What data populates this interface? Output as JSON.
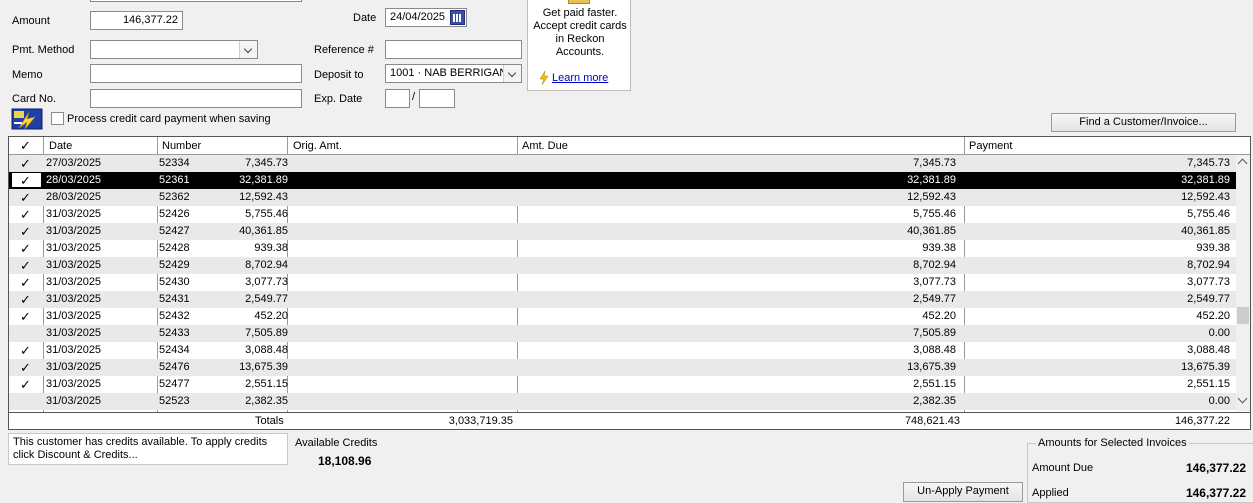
{
  "form": {
    "amount_label": "Amount",
    "amount_value": "146,377.22",
    "date_label": "Date",
    "date_value": "24/04/2025",
    "pmt_method_label": "Pmt. Method",
    "pmt_method_value": "",
    "reference_label": "Reference #",
    "reference_value": "",
    "memo_label": "Memo",
    "memo_value": "",
    "deposit_label": "Deposit to",
    "deposit_value": "1001 · NAB BERRIGAN",
    "cardno_label": "Card No.",
    "cardno_value": "",
    "expdate_label": "Exp. Date",
    "exp_sep": "/",
    "process_cc_label": "Process credit card payment when saving"
  },
  "ad": {
    "text_line1": "Get paid faster.",
    "text_line2": "Accept credit cards",
    "text_line3": "in Reckon",
    "text_line4": "Accounts.",
    "link": "Learn more"
  },
  "find_button": "Find a Customer/Invoice...",
  "table": {
    "headers": {
      "check": "✓",
      "date": "Date",
      "number": "Number",
      "orig": "Orig. Amt.",
      "due": "Amt. Due",
      "payment": "Payment"
    },
    "rows": [
      {
        "check": "✓",
        "date": "27/03/2025",
        "number": "52334",
        "orig": "7,345.73",
        "due": "7,345.73",
        "payment": "7,345.73"
      },
      {
        "check": "✓",
        "date": "28/03/2025",
        "number": "52361",
        "orig": "32,381.89",
        "due": "32,381.89",
        "payment": "32,381.89"
      },
      {
        "check": "✓",
        "date": "28/03/2025",
        "number": "52362",
        "orig": "12,592.43",
        "due": "12,592.43",
        "payment": "12,592.43"
      },
      {
        "check": "✓",
        "date": "31/03/2025",
        "number": "52426",
        "orig": "5,755.46",
        "due": "5,755.46",
        "payment": "5,755.46"
      },
      {
        "check": "✓",
        "date": "31/03/2025",
        "number": "52427",
        "orig": "40,361.85",
        "due": "40,361.85",
        "payment": "40,361.85"
      },
      {
        "check": "✓",
        "date": "31/03/2025",
        "number": "52428",
        "orig": "939.38",
        "due": "939.38",
        "payment": "939.38"
      },
      {
        "check": "✓",
        "date": "31/03/2025",
        "number": "52429",
        "orig": "8,702.94",
        "due": "8,702.94",
        "payment": "8,702.94"
      },
      {
        "check": "✓",
        "date": "31/03/2025",
        "number": "52430",
        "orig": "3,077.73",
        "due": "3,077.73",
        "payment": "3,077.73"
      },
      {
        "check": "✓",
        "date": "31/03/2025",
        "number": "52431",
        "orig": "2,549.77",
        "due": "2,549.77",
        "payment": "2,549.77"
      },
      {
        "check": "✓",
        "date": "31/03/2025",
        "number": "52432",
        "orig": "452.20",
        "due": "452.20",
        "payment": "452.20"
      },
      {
        "check": "",
        "date": "31/03/2025",
        "number": "52433",
        "orig": "7,505.89",
        "due": "7,505.89",
        "payment": "0.00"
      },
      {
        "check": "✓",
        "date": "31/03/2025",
        "number": "52434",
        "orig": "3,088.48",
        "due": "3,088.48",
        "payment": "3,088.48"
      },
      {
        "check": "✓",
        "date": "31/03/2025",
        "number": "52476",
        "orig": "13,675.39",
        "due": "13,675.39",
        "payment": "13,675.39"
      },
      {
        "check": "✓",
        "date": "31/03/2025",
        "number": "52477",
        "orig": "2,551.15",
        "due": "2,551.15",
        "payment": "2,551.15"
      },
      {
        "check": "",
        "date": "31/03/2025",
        "number": "52523",
        "orig": "2,382.35",
        "due": "2,382.35",
        "payment": "0.00"
      }
    ],
    "selected_row": 1,
    "totals": {
      "label": "Totals",
      "orig": "3,033,719.35",
      "due": "748,621.43",
      "payment": "146,377.22"
    }
  },
  "credits": {
    "message": "This customer has credits available. To apply credits click Discount & Credits...",
    "available_label": "Available Credits",
    "available_value": "18,108.96"
  },
  "unapply_button": "Un-Apply Payment",
  "summary": {
    "title": "Amounts for Selected Invoices",
    "amount_due_label": "Amount Due",
    "amount_due_value": "146,377.22",
    "applied_label": "Applied",
    "applied_value": "146,377.22"
  },
  "colors": {
    "selected_row_bg": "#000000",
    "alt_row_bg": "#e9e9e9",
    "link": "#0000cc"
  }
}
